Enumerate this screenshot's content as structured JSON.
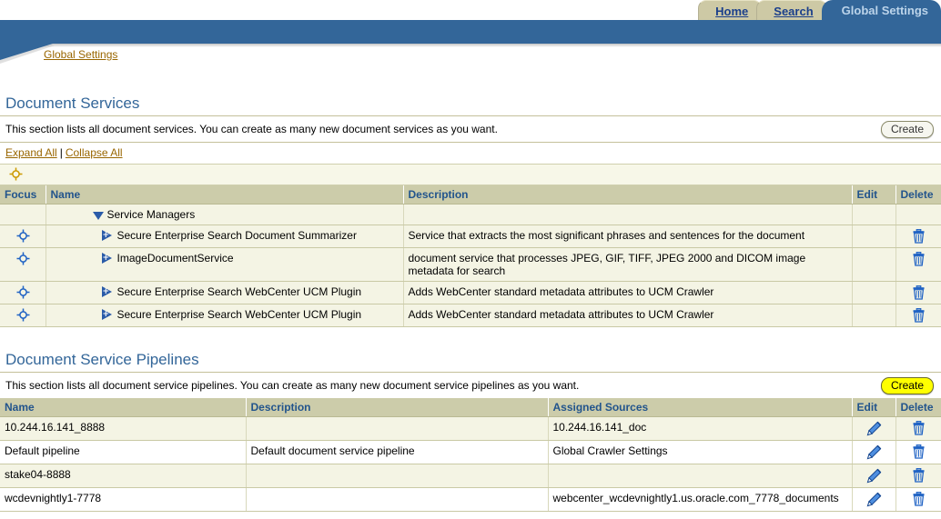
{
  "tabs": [
    {
      "label": "Home",
      "active": false
    },
    {
      "label": "Search",
      "active": false
    },
    {
      "label": "Global Settings",
      "active": true
    }
  ],
  "breadcrumb": {
    "label": "Global Settings"
  },
  "sections": [
    {
      "title": "Document Services",
      "description": "This section lists all document services. You can create as many new document services as you want.",
      "create_label": "Create",
      "create_highlighted": false,
      "expand_all_label": "Expand All",
      "collapse_all_label": "Collapse All",
      "separator": "|",
      "focus_all_icon": "focus-crosshair-gold-icon",
      "columns": [
        "Focus",
        "Name",
        "Description",
        "Edit",
        "Delete"
      ],
      "rows": [
        {
          "kind": "root",
          "focus": "",
          "expander": "triangle-down-icon",
          "name": "Service Managers",
          "description": "",
          "edit": "",
          "delete": ""
        },
        {
          "kind": "child",
          "focus": "focus-crosshair-blue-icon",
          "expander": "triangle-right-plus-icon",
          "name": "Secure Enterprise Search Document Summarizer",
          "description": "Service that extracts the most significant phrases and sentences for the document",
          "edit": "",
          "delete": "trash-icon"
        },
        {
          "kind": "child",
          "focus": "focus-crosshair-blue-icon",
          "expander": "triangle-right-plus-icon",
          "name": "ImageDocumentService",
          "description": "document service that processes JPEG, GIF, TIFF, JPEG 2000 and DICOM image metadata for search",
          "edit": "",
          "delete": "trash-icon"
        },
        {
          "kind": "child",
          "focus": "focus-crosshair-blue-icon",
          "expander": "triangle-right-plus-icon",
          "name": "Secure Enterprise Search WebCenter UCM Plugin",
          "description": "Adds WebCenter standard metadata attributes to UCM Crawler",
          "edit": "",
          "delete": "trash-icon"
        },
        {
          "kind": "child",
          "focus": "focus-crosshair-blue-icon",
          "expander": "triangle-right-plus-icon",
          "name": "Secure Enterprise Search WebCenter UCM Plugin",
          "description": "Adds WebCenter standard metadata attributes to UCM Crawler",
          "edit": "",
          "delete": "trash-icon"
        }
      ]
    },
    {
      "title": "Document Service Pipelines",
      "description": "This section lists all document service pipelines. You can create as many new document service pipelines as you want.",
      "create_label": "Create",
      "create_highlighted": true,
      "columns": [
        "Name",
        "Description",
        "Assigned Sources",
        "Edit",
        "Delete"
      ],
      "rows": [
        {
          "name": "10.244.16.141_8888",
          "description": "",
          "assigned_sources": "10.244.16.141_doc",
          "edit": "pencil-icon",
          "delete": "trash-icon"
        },
        {
          "name": "Default pipeline",
          "description": "Default document service pipeline",
          "assigned_sources": "Global Crawler Settings",
          "edit": "pencil-icon",
          "delete": "trash-icon"
        },
        {
          "name": "stake04-8888",
          "description": "",
          "assigned_sources": "",
          "edit": "pencil-icon",
          "delete": "trash-icon"
        },
        {
          "name": "wcdevnightly1-7778",
          "description": "",
          "assigned_sources": "webcenter_wcdevnightly1.us.oracle.com_7778_documents",
          "edit": "pencil-icon",
          "delete": "trash-icon"
        }
      ]
    }
  ],
  "colors": {
    "band_blue": "#336699",
    "tab_inactive": "#cdc9a5",
    "header_row": "#ccccaa",
    "row_alt": "#f4f4e4",
    "link_gold": "#996600",
    "heading_blue": "#336699",
    "icon_blue": "#1f62c4",
    "highlight_yellow": "#ffff00"
  }
}
